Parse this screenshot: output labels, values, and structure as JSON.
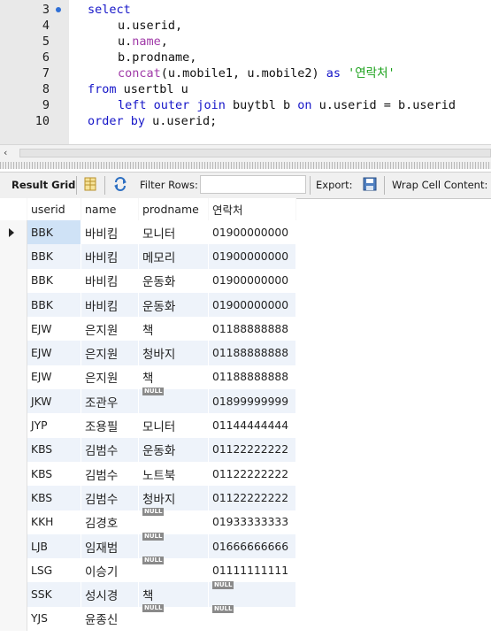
{
  "editor": {
    "lines": [
      {
        "num": "3",
        "bookmark": true
      },
      {
        "num": "4"
      },
      {
        "num": "5"
      },
      {
        "num": "6"
      },
      {
        "num": "7"
      },
      {
        "num": "8"
      },
      {
        "num": "9"
      },
      {
        "num": "10"
      }
    ],
    "code": {
      "l3": "select",
      "l4": "u.userid,",
      "l5a": "u.",
      "l5b": "name",
      "l5c": ",",
      "l6": "b.prodname,",
      "l7a": "concat",
      "l7b": "(u.mobile1, u.mobile2) ",
      "l7c": "as",
      "l7d": " '연락처'",
      "l8a": "from",
      "l8b": " usertbl u",
      "l9a": "left outer join",
      "l9b": " buytbl b ",
      "l9c": "on",
      "l9d": " u.userid = b.userid",
      "l10a": "order by",
      "l10b": " u.userid;"
    }
  },
  "scrollbar": {
    "left_arrow": "‹"
  },
  "toolbar": {
    "result_grid": "Result Grid",
    "filter_rows": "Filter Rows:",
    "export": "Export:",
    "wrap": "Wrap Cell Content:",
    "filter_value": ""
  },
  "grid": {
    "columns": [
      "userid",
      "name",
      "prodname",
      "연락처"
    ],
    "null_label": "NULL",
    "rows": [
      [
        "BBK",
        "바비킴",
        "모니터",
        "01900000000"
      ],
      [
        "BBK",
        "바비킴",
        "메모리",
        "01900000000"
      ],
      [
        "BBK",
        "바비킴",
        "운동화",
        "01900000000"
      ],
      [
        "BBK",
        "바비킴",
        "운동화",
        "01900000000"
      ],
      [
        "EJW",
        "은지원",
        "책",
        "01188888888"
      ],
      [
        "EJW",
        "은지원",
        "청바지",
        "01188888888"
      ],
      [
        "EJW",
        "은지원",
        "책",
        "01188888888"
      ],
      [
        "JKW",
        "조관우",
        null,
        "01899999999"
      ],
      [
        "JYP",
        "조용필",
        "모니터",
        "01144444444"
      ],
      [
        "KBS",
        "김범수",
        "운동화",
        "01122222222"
      ],
      [
        "KBS",
        "김범수",
        "노트북",
        "01122222222"
      ],
      [
        "KBS",
        "김범수",
        "청바지",
        "01122222222"
      ],
      [
        "KKH",
        "김경호",
        null,
        "01933333333"
      ],
      [
        "LJB",
        "임재범",
        null,
        "01666666666"
      ],
      [
        "LSG",
        "이승기",
        null,
        "01111111111"
      ],
      [
        "SSK",
        "성시경",
        "책",
        null
      ],
      [
        "YJS",
        "윤종신",
        null,
        null
      ]
    ]
  }
}
